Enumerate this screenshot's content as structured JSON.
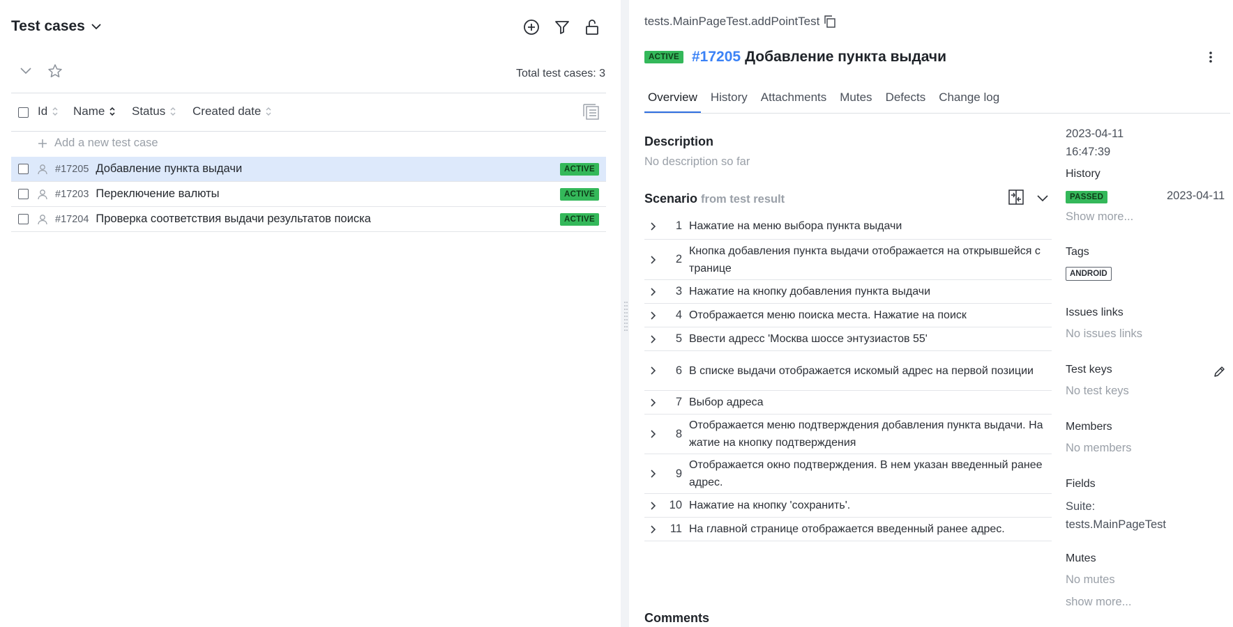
{
  "left": {
    "title": "Test cases",
    "total_label": "Total test cases: 3",
    "columns": {
      "id": "Id",
      "name": "Name",
      "status": "Status",
      "created": "Created date"
    },
    "add_label": "Add a new test case",
    "rows": [
      {
        "id": "#17205",
        "name": "Добавление пункта выдачи",
        "status": "ACTIVE"
      },
      {
        "id": "#17203",
        "name": "Переключение валюты",
        "status": "ACTIVE"
      },
      {
        "id": "#17204",
        "name": "Проверка соответствия выдачи результатов поиска",
        "status": "ACTIVE"
      }
    ]
  },
  "right": {
    "path": "tests.MainPageTest.addPointTest",
    "status": "ACTIVE",
    "case_id": "#17205",
    "case_title": "Добавление пункта выдачи",
    "tabs": [
      "Overview",
      "History",
      "Attachments",
      "Mutes",
      "Defects",
      "Change log"
    ],
    "description_title": "Description",
    "description_empty": "No description so far",
    "scenario_title": "Scenario",
    "scenario_source": "from test result",
    "steps": [
      {
        "n": "1",
        "text": "Нажатие на меню выбора пункта выдачи"
      },
      {
        "n": "2",
        "text": "Кнопка добавления пункта выдачи отображается на открывшейся странице"
      },
      {
        "n": "3",
        "text": "Нажатие на кнопку добавления пункта выдачи"
      },
      {
        "n": "4",
        "text": "Отображается меню поиска места. Нажатие на поиск"
      },
      {
        "n": "5",
        "text": "Ввести адресс 'Москва шоссе энтузиастов 55'"
      },
      {
        "n": "6",
        "text": "В списке выдачи отображается искомый адрес на первой позиции"
      },
      {
        "n": "7",
        "text": "Выбор адреса"
      },
      {
        "n": "8",
        "text": "Отображается меню подтверждения добавления пункта выдачи. Нажатие на кнопку подтверждения"
      },
      {
        "n": "9",
        "text": "Отображается окно подтверждения. В нем указан введенный ранее адрес."
      },
      {
        "n": "10",
        "text": "Нажатие на кнопку 'сохранить'."
      },
      {
        "n": "11",
        "text": "На главной странице отображается введенный ранее адрес."
      }
    ],
    "comments_title": "Comments",
    "sidebar": {
      "created_date": "2023-04-11",
      "created_time": "16:47:39",
      "history_title": "History",
      "history_status": "PASSED",
      "history_date": "2023-04-11",
      "show_more": "Show more...",
      "tags_title": "Tags",
      "tag": "ANDROID",
      "issues_title": "Issues links",
      "issues_empty": "No issues links",
      "keys_title": "Test keys",
      "keys_empty": "No test keys",
      "members_title": "Members",
      "members_empty": "No members",
      "fields_title": "Fields",
      "suite_label": "Suite:",
      "suite_value": "tests.MainPageTest",
      "mutes_title": "Mutes",
      "mutes_empty": "No mutes",
      "show_more_lower": "show more..."
    }
  },
  "colors": {
    "accent": "#3b82f6",
    "active_badge": "#34b85a",
    "selected_row": "#dde9fb"
  },
  "icons": [
    "chevron-down-icon",
    "plus-circle-icon",
    "filter-icon",
    "unlock-icon",
    "star-icon",
    "sort-icon",
    "tree-view-icon",
    "plus-icon",
    "person-icon",
    "copy-icon",
    "more-vertical-icon",
    "compare-icon",
    "chevron-right-icon",
    "pencil-icon"
  ]
}
